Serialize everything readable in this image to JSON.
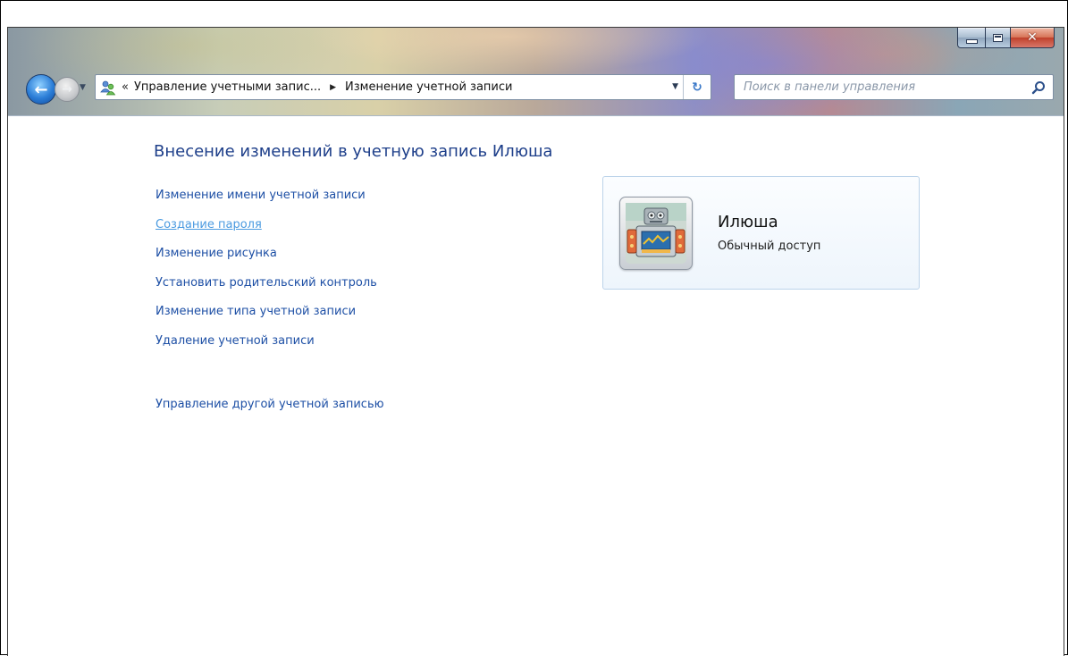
{
  "window": {
    "address_parent": "Управление учетными запис...",
    "address_current": "Изменение учетной записи",
    "address_prefix": "«",
    "search_placeholder": "Поиск в панели управления"
  },
  "main": {
    "heading": "Внесение изменений в учетную запись Илюша",
    "tasks": [
      "Изменение имени учетной записи",
      "Создание пароля",
      "Изменение рисунка",
      "Установить родительский контроль",
      "Изменение типа учетной записи",
      "Удаление учетной записи"
    ],
    "other_account_link": "Управление другой учетной записью",
    "hovered_task_index": 1
  },
  "user": {
    "name": "Илюша",
    "account_type": "Обычный доступ",
    "avatar": "robot-avatar"
  },
  "colors": {
    "link": "#1d4fa5",
    "link_hover": "#4a9ae0",
    "heading": "#1e3f8a",
    "close_button": "#c0402a"
  },
  "icons": [
    "back-arrow-icon",
    "forward-arrow-icon",
    "user-accounts-icon",
    "refresh-icon",
    "search-icon",
    "minimize-icon",
    "maximize-icon",
    "close-icon"
  ]
}
